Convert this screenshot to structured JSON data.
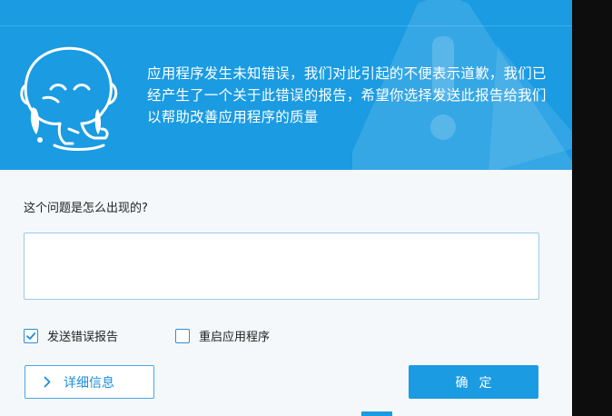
{
  "header": {
    "message": "应用程序发生未知错误，我们对此引起的不便表示道歉，我们已经产生了一个关于此错误的报告，希望你选择发送此报告给我们以帮助改善应用程序的质量"
  },
  "form": {
    "question_label": "这个问题是怎么出现的?",
    "textarea_value": "",
    "options": [
      {
        "label": "发送错误报告",
        "checked": true
      },
      {
        "label": "重启应用程序",
        "checked": false
      }
    ]
  },
  "buttons": {
    "details_label": "详细信息",
    "ok_label": "确定"
  },
  "colors": {
    "accent": "#1a9be2",
    "background": "#f4f8fb"
  },
  "icons": [
    "crying-mascot-icon",
    "warning-triangle-icon",
    "checkmark-icon",
    "chevron-right-icon"
  ]
}
